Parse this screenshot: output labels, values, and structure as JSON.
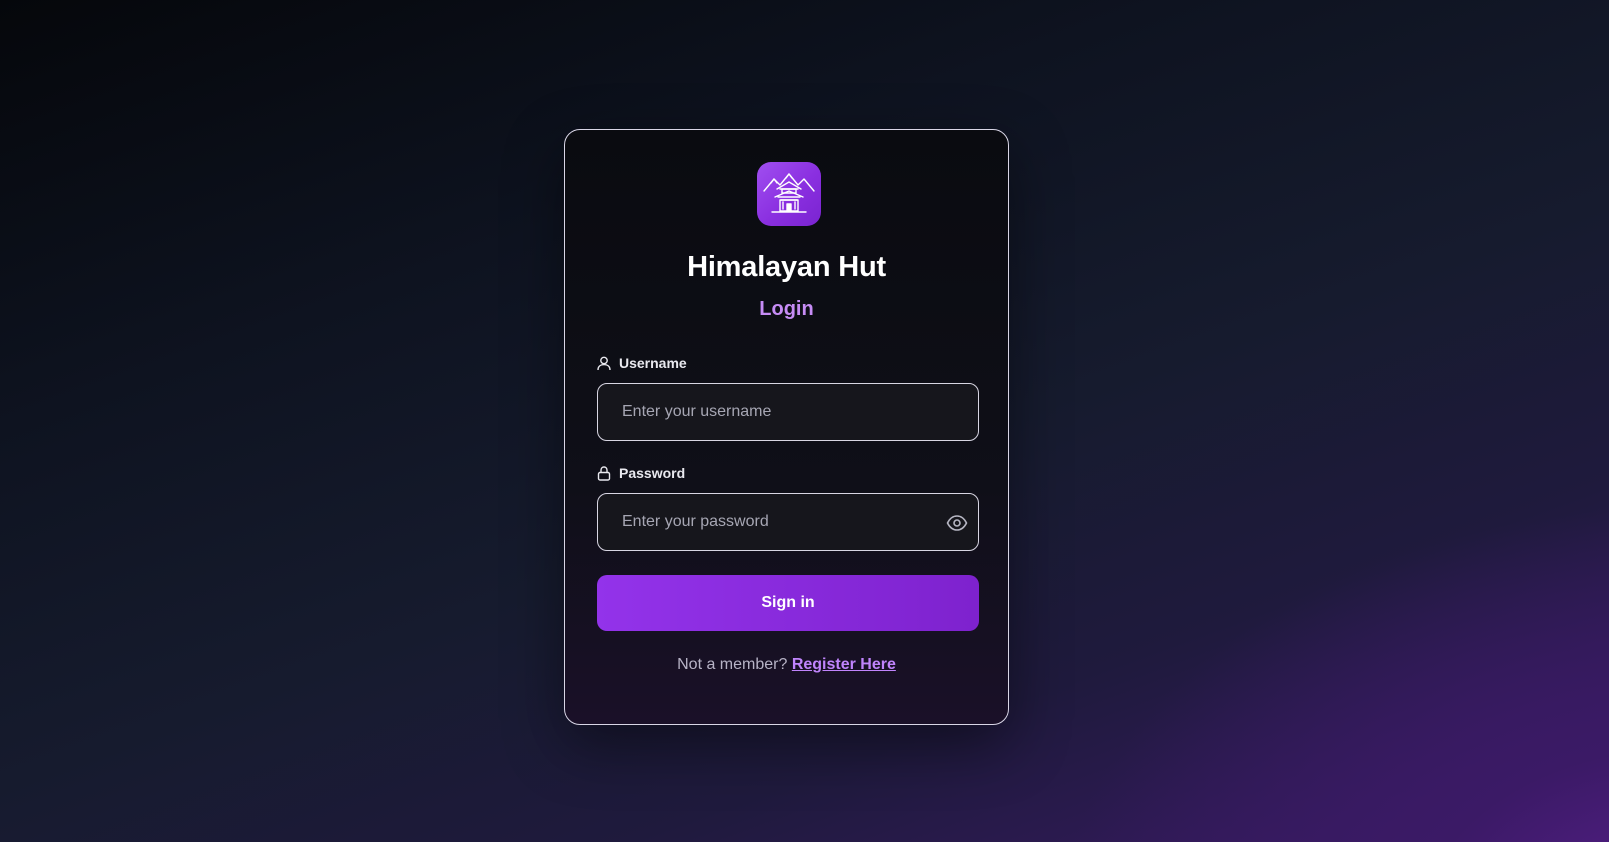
{
  "brand": {
    "name": "Himalayan Hut",
    "logo_icon": "mountain-hut-icon",
    "accent_color": "#9333ea"
  },
  "page": {
    "subtitle": "Login"
  },
  "form": {
    "username": {
      "label": "Username",
      "icon": "user-icon",
      "placeholder": "Enter your username",
      "value": ""
    },
    "password": {
      "label": "Password",
      "icon": "lock-icon",
      "placeholder": "Enter your password",
      "value": "",
      "toggle_icon": "eye-icon"
    },
    "submit_label": "Sign in"
  },
  "footer": {
    "prompt": "Not a member?",
    "link_label": "Register Here"
  }
}
